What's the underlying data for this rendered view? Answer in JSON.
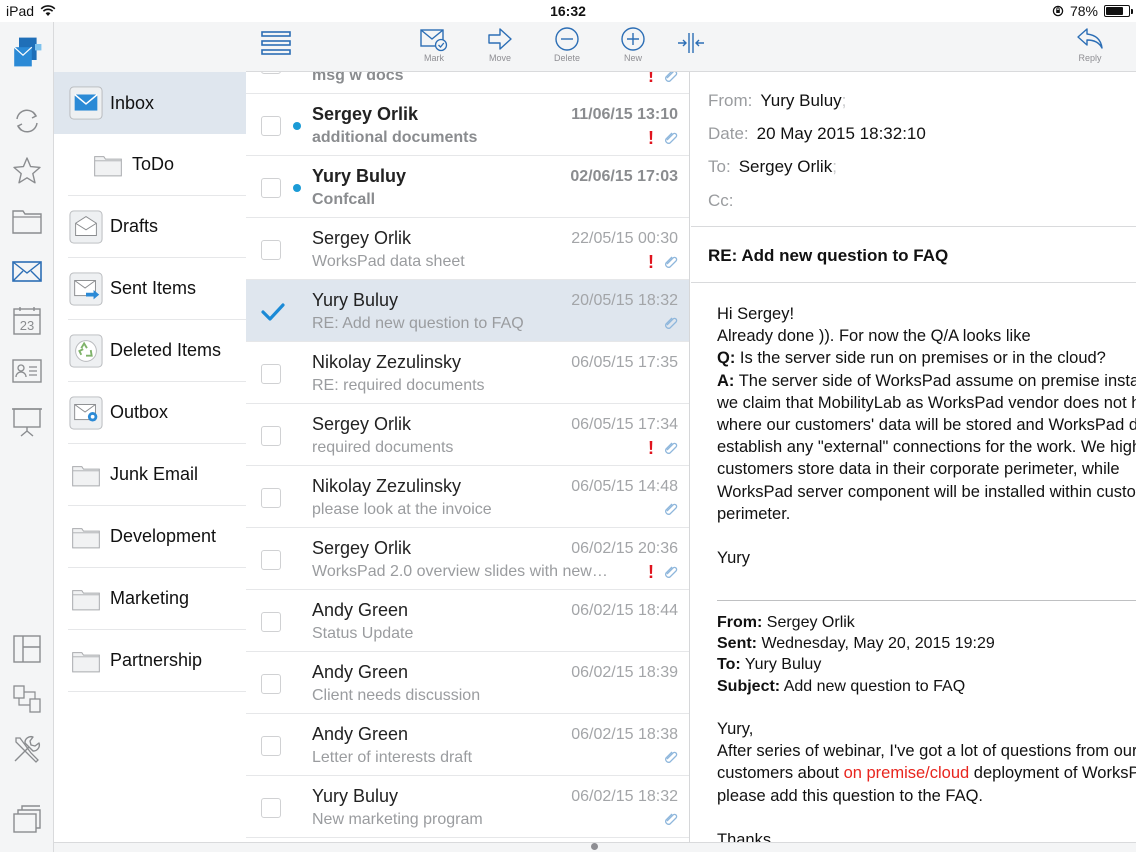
{
  "status_bar": {
    "device": "iPad",
    "time": "16:32",
    "battery": "78%",
    "battery_level": 0.78
  },
  "app": {
    "rail_items": [
      {
        "name": "app-logo-icon"
      },
      {
        "name": "sync-icon"
      },
      {
        "name": "favorites-star-icon"
      },
      {
        "name": "documents-folder-icon"
      },
      {
        "name": "mail-icon"
      },
      {
        "name": "calendar-icon",
        "label": "23"
      },
      {
        "name": "contacts-card-icon"
      },
      {
        "name": "presentation-icon"
      },
      {
        "name": "layout-panels-icon"
      },
      {
        "name": "network-devices-icon"
      },
      {
        "name": "tools-icon"
      },
      {
        "name": "windows-stack-icon"
      }
    ]
  },
  "folders": [
    {
      "label": "Inbox",
      "icon": "inbox-icon",
      "active": true
    },
    {
      "label": "ToDo",
      "icon": "folder-icon",
      "sub": true
    },
    {
      "label": "Drafts",
      "icon": "drafts-icon"
    },
    {
      "label": "Sent Items",
      "icon": "sent-items-icon"
    },
    {
      "label": "Deleted Items",
      "icon": "recycle-icon"
    },
    {
      "label": "Outbox",
      "icon": "outbox-icon"
    },
    {
      "label": "Junk Email",
      "icon": "folder-icon"
    },
    {
      "label": "Development",
      "icon": "folder-icon"
    },
    {
      "label": "Marketing",
      "icon": "folder-icon"
    },
    {
      "label": "Partnership",
      "icon": "folder-icon"
    }
  ],
  "toolbar": {
    "mark": "Mark",
    "move": "Move",
    "delete": "Delete",
    "new": "New",
    "reply": "Reply"
  },
  "messages": [
    {
      "sender": "",
      "subject": "msg w docs",
      "date": "",
      "important": true,
      "attachment": true,
      "unread": true,
      "partial": true
    },
    {
      "sender": "Sergey Orlik",
      "subject": "additional documents",
      "date": "11/06/15 13:10",
      "important": true,
      "attachment": true,
      "unread": true
    },
    {
      "sender": "Yury Buluy",
      "subject": "Confcall",
      "date": "02/06/15 17:03",
      "important": false,
      "attachment": false,
      "unread": true
    },
    {
      "sender": "Sergey Orlik",
      "subject": "WorksPad data sheet",
      "date": "22/05/15 00:30",
      "important": true,
      "attachment": true,
      "unread": false
    },
    {
      "sender": "Yury Buluy",
      "subject": "RE: Add new question to FAQ",
      "date": "20/05/15 18:32",
      "important": false,
      "attachment": true,
      "unread": false,
      "selected": true
    },
    {
      "sender": "Nikolay Zezulinsky",
      "subject": "RE: required documents",
      "date": "06/05/15 17:35",
      "important": false,
      "attachment": false,
      "unread": false
    },
    {
      "sender": "Sergey Orlik",
      "subject": "required documents",
      "date": "06/05/15 17:34",
      "important": true,
      "attachment": true,
      "unread": false
    },
    {
      "sender": "Nikolay Zezulinsky",
      "subject": "please look at the invoice",
      "date": "06/05/15 14:48",
      "important": false,
      "attachment": true,
      "unread": false
    },
    {
      "sender": "Sergey Orlik",
      "subject": "WorksPad 2.0 overview slides with new…",
      "date": "06/02/15 20:36",
      "important": true,
      "attachment": true,
      "unread": false
    },
    {
      "sender": "Andy Green",
      "subject": "Status Update",
      "date": "06/02/15 18:44",
      "important": false,
      "attachment": false,
      "unread": false
    },
    {
      "sender": "Andy Green",
      "subject": "Client needs discussion",
      "date": "06/02/15 18:39",
      "important": false,
      "attachment": false,
      "unread": false
    },
    {
      "sender": "Andy Green",
      "subject": "Letter of interests draft",
      "date": "06/02/15 18:38",
      "important": false,
      "attachment": true,
      "unread": false
    },
    {
      "sender": "Yury Buluy",
      "subject": "New marketing program",
      "date": "06/02/15 18:32",
      "important": false,
      "attachment": true,
      "unread": false
    }
  ],
  "reader": {
    "from_label": "From:",
    "from_value": "Yury Buluy",
    "date_label": "Date:",
    "date_value": "20 May 2015 18:32:10",
    "to_label": "To:",
    "to_value": "Sergey Orlik",
    "cc_label": "Cc:",
    "subject": "RE: Add new question to FAQ",
    "body": {
      "greeting": "Hi Sergey!",
      "line1": "Already done )). For now the Q/A looks like",
      "q_label": "Q:",
      "q_text": " Is the server side run on premises or in the cloud?",
      "a_label": "A:",
      "a_text": " The server side of WorksPad assume on premise installation. It means that",
      "line4": "we claim that MobilityLab as WorksPad vendor does not have any control",
      "line5": "where our customers' data will be stored and WorksPad doesn't",
      "line6": "establish any \"external\" connections for the work. We highly recommend our",
      "line7": "customers store data in their corporate perimeter, while",
      "line8": "WorksPad server component will be installed within customer corporate",
      "line9": "perimeter.",
      "sign": "Yury"
    },
    "forward": {
      "from_label": "From:",
      "from_value": " Sergey Orlik",
      "sent_label": "Sent:",
      "sent_value": " Wednesday, May 20, 2015 19:29",
      "to_label": "To:",
      "to_value": " Yury Buluy",
      "subject_label": "Subject:",
      "subject_value": " Add new question to FAQ"
    },
    "body2": {
      "greeting": "Yury,",
      "line1": "After series of webinar, I've got a lot of questions from our",
      "line2_pre": "customers about ",
      "line2_red": "on premise/cloud",
      "line2_post": " deployment of WorksPad. Could you",
      "line3": "please add this question to the FAQ.",
      "thanks": "Thanks,"
    }
  }
}
